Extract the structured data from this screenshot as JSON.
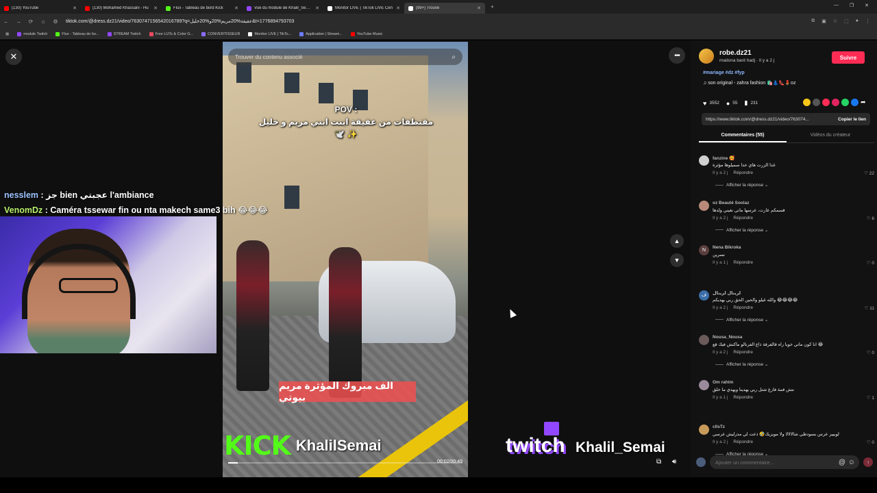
{
  "browser": {
    "tabs": [
      {
        "title": "(130) YouTube",
        "color": "#ff0000",
        "active": false
      },
      {
        "title": "(130) Mohamed Khassani - Hu",
        "color": "#ff0000",
        "active": false
      },
      {
        "title": "Flux - Tableau de bord Kick",
        "color": "#53fc18",
        "active": false
      },
      {
        "title": "Vue du module de Khalil_Semai",
        "color": "#9147ff",
        "active": false
      },
      {
        "title": "Monitor LIVE | TikTok LIVE Cen",
        "color": "#ffffff",
        "active": false
      },
      {
        "title": "(99+) Trouve",
        "color": "#ffffff",
        "active": true
      }
    ],
    "url": "tiktok.com/@dress.dz21/video/7630747156542016789?q=عقيقة%20مريم%20و%20خليل&t=1776894793703",
    "bookmarks": [
      {
        "label": "module  Twitch",
        "color": "#9147ff"
      },
      {
        "label": "Flux - Tableau de bo...",
        "color": "#53fc18"
      },
      {
        "label": "STREAM Twitch",
        "color": "#9147ff"
      },
      {
        "label": "Free LUTs & Color G...",
        "color": "#e84a5f"
      },
      {
        "label": "CONVERTISSEUR",
        "color": "#8a6cff"
      },
      {
        "label": "Monitor LIVE | TikTo...",
        "color": "#ffffff"
      },
      {
        "label": "Application | Stream...",
        "color": "#6c7cff"
      },
      {
        "label": "YouTube Music",
        "color": "#ff0000"
      }
    ]
  },
  "video": {
    "search_placeholder": "Trouver du contenu associé",
    "overlay_title": "POV :\nمقتطفات من عقيقة ابنت ابني مريم و خليل 🕊️ ✨",
    "banner": "الف مبروك المؤثرة مريم بيوتي",
    "time": "00:02/00:49",
    "progress": 0.04
  },
  "stream": {
    "kick_logo": "KICK",
    "kick_name": "KhalilSemai",
    "twitch_logo": "twitch",
    "twitch_name": "Khalil_Semai",
    "chat": [
      {
        "user": "nesslem",
        "message": "جز bien عجبتي l'ambiance"
      },
      {
        "user": "VenomDz",
        "message": "Caméra tssewar fin ou nta makech same3 bih 😂😂😂"
      }
    ]
  },
  "panel": {
    "author": "robe.dz21",
    "author_sub": "madona bant hadj · Il y a 2 j",
    "follow": "Suivre",
    "hashtags": "#mariage #dz #fyp",
    "music": "♫ son original - zahra fashion 🛍️👗👠💄oz",
    "likes": "3552",
    "comments_count": "55",
    "saves": "231",
    "link": "https://www.tiktok.com/@dress.dz21/video/763074...",
    "copy": "Copier le lien",
    "tab_comments": "Commentaires (55)",
    "tab_creator": "Vidéos du créateur",
    "reply_label": "Répondre",
    "show_replies": "Afficher la réponse",
    "comment_placeholder": "Ajouter un commentaire...",
    "comments": [
      {
        "user": "fanzine 🥰",
        "text": "غدا الزرت هاي خدا سميلوها مؤثرة",
        "time": "Il y a 2 j",
        "likes": "22",
        "avatar_color": "#d0d0d0",
        "initial": "",
        "replies": true
      },
      {
        "user": "oz Beauté Soolaz",
        "text": "قسمكم عارت، عرسها ماتي نغيني ولدها",
        "time": "Il y a 2 j",
        "likes": "6",
        "avatar_color": "#b98a7a",
        "initial": "",
        "replies": true
      },
      {
        "user": "Nena Bikroka",
        "text": "نسرين",
        "time": "Il y a 1 j",
        "likes": "0",
        "avatar_color": "#5b3e3e",
        "initial": "N",
        "replies": false
      },
      {
        "user": "لريتال لريتال",
        "text": "والله غيلو والحين الحق ربي يهديكم 😂😂😂😂",
        "time": "Il y a 2 j",
        "likes": "11",
        "avatar_color": "#3b6ea8",
        "initial": "ف",
        "replies": true
      },
      {
        "user": "Nousa_Nousa",
        "text": "انا كون ماتي خويا راه قالفرقة ذاع الفرتالو ماكنش فيك قع 😂",
        "time": "Il y a 2 j",
        "likes": "0",
        "avatar_color": "#6a5a5a",
        "initial": "",
        "replies": true
      },
      {
        "user": "Om rahim",
        "text": "نتش قمة فارغ شتل ربي يهدينا ويهدي ما خلق",
        "time": "Il y a 1 j",
        "likes": "1",
        "avatar_color": "#9a8a9a",
        "initial": "",
        "replies": false
      },
      {
        "user": "cllsTz",
        "text": "لوبيير عرس بسودطي شالالالا ولا مويزيك🤣 ذعت لي مدزليش عرسي",
        "time": "Il y a 2 j",
        "likes": "0",
        "avatar_color": "#c89a5a",
        "initial": "",
        "replies": true
      }
    ]
  }
}
